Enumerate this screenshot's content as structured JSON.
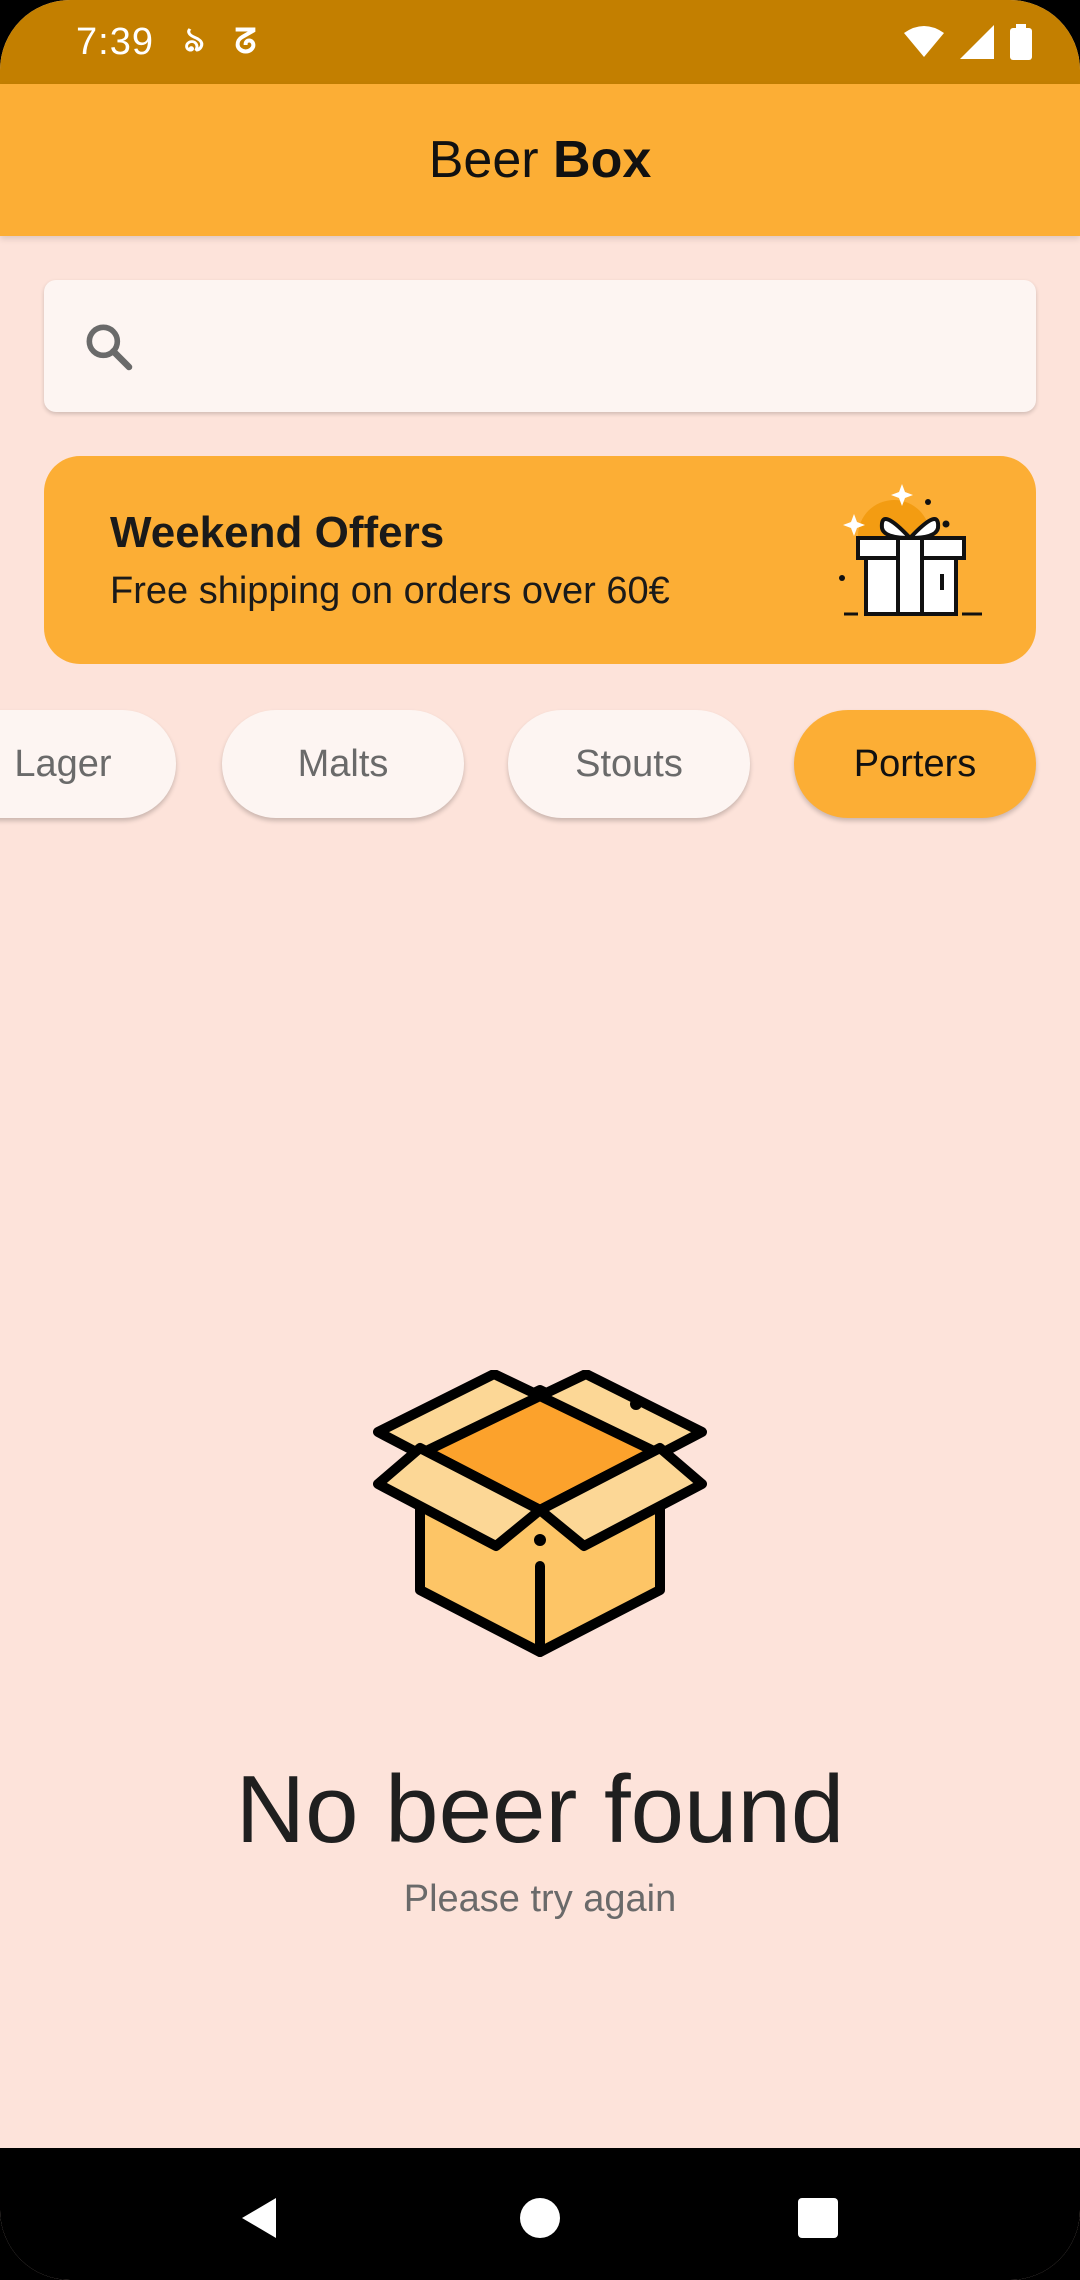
{
  "status_bar": {
    "time": "7:39",
    "glyph_1": "ঌ",
    "glyph_2": "ᘔ",
    "icons": [
      "wifi-icon",
      "signal-icon",
      "battery-icon"
    ]
  },
  "app_bar": {
    "title_regular": "Beer",
    "title_bold": "Box"
  },
  "search": {
    "placeholder": "",
    "value": ""
  },
  "offer": {
    "title": "Weekend Offers",
    "subtitle": "Free shipping on orders over 60€"
  },
  "chips": [
    {
      "label": "Lager",
      "selected": false
    },
    {
      "label": "Malts",
      "selected": false
    },
    {
      "label": "Stouts",
      "selected": false
    },
    {
      "label": "Porters",
      "selected": true
    }
  ],
  "empty_state": {
    "title": "No beer found",
    "subtitle": "Please try again"
  },
  "colors": {
    "status_bar": "#C37F00",
    "accent": "#FCAE35",
    "background": "#FDE3DA",
    "box_light": "#FCD796",
    "box_mid": "#FDC566",
    "box_dark": "#FCA22C"
  }
}
